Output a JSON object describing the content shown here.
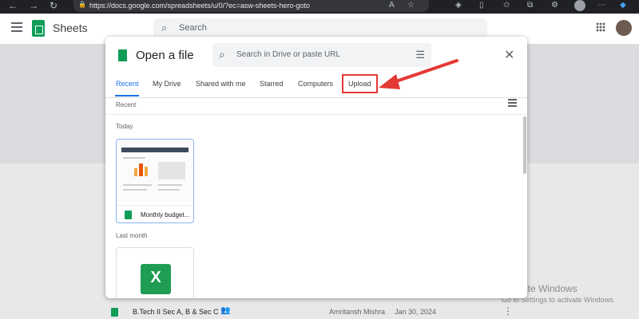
{
  "browser": {
    "url": "https://docs.google.com/spreadsheets/u/0/?ec=asw-sheets-hero-goto"
  },
  "header": {
    "app_name": "Sheets",
    "search_placeholder": "Search"
  },
  "dialog": {
    "title": "Open a file",
    "search_placeholder": "Search in Drive or paste URL",
    "tabs": [
      {
        "label": "Recent",
        "active": true
      },
      {
        "label": "My Drive",
        "active": false
      },
      {
        "label": "Shared with me",
        "active": false
      },
      {
        "label": "Starred",
        "active": false
      },
      {
        "label": "Computers",
        "active": false
      },
      {
        "label": "Upload",
        "active": false,
        "highlighted": true
      }
    ],
    "section_recent": "Recent",
    "group_today": "Today",
    "group_last_month": "Last month",
    "files": [
      {
        "name": "Monthly budget...",
        "type": "sheets"
      },
      {
        "name": "",
        "type": "excel",
        "icon_letter": "X"
      }
    ]
  },
  "file_list_row": {
    "name": "B.Tech II Sec A, B & Sec C",
    "owner": "Amritansh Mishra",
    "date": "Jan 30, 2024"
  },
  "watermark": {
    "title": "Activate Windows",
    "subtitle": "Go to Settings to activate Windows."
  },
  "colors": {
    "accent": "#1a73e8",
    "sheets_green": "#0f9d58",
    "highlight_red": "#e53935"
  }
}
